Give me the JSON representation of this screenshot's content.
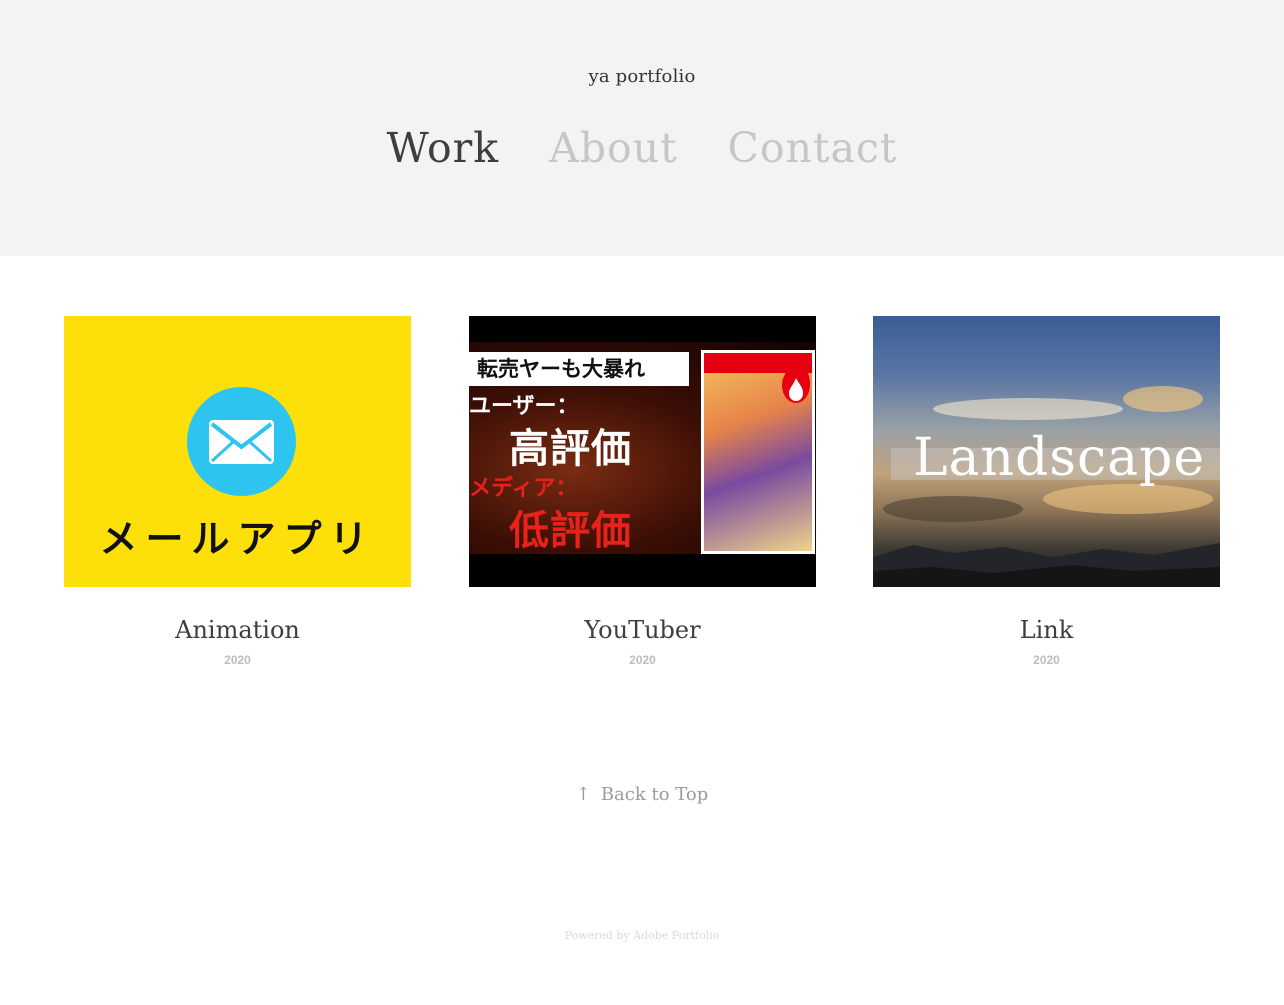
{
  "header": {
    "site_title": "ya portfolio",
    "nav": [
      {
        "label": "Work",
        "active": true
      },
      {
        "label": "About",
        "active": false
      },
      {
        "label": "Contact",
        "active": false
      }
    ]
  },
  "projects": [
    {
      "title": "Animation",
      "year": "2020",
      "thumbnail": {
        "icon": "mail-envelope-icon",
        "text": "メールアプリ",
        "background": "#fddf0a"
      }
    },
    {
      "title": "YouTuber",
      "year": "2020",
      "thumbnail": {
        "banner": "転売ヤーも大暴れ",
        "line1": "ユーザー：",
        "line2": "高評価",
        "line3": "メディア：",
        "line4": "低評価",
        "icon": "fire-icon"
      }
    },
    {
      "title": "Link",
      "year": "2020",
      "thumbnail": {
        "text": "Landscape"
      }
    }
  ],
  "footer": {
    "back_to_top": "Back to Top",
    "back_to_top_icon": "↑",
    "powered_by": "Powered by Adobe Portfolio"
  },
  "colors": {
    "header_bg": "#f3f3f2",
    "nav_active": "#3e3e3e",
    "nav_inactive": "#c7c6c3",
    "mail_blue": "#2ec4f0",
    "yellow": "#fddf0a"
  }
}
